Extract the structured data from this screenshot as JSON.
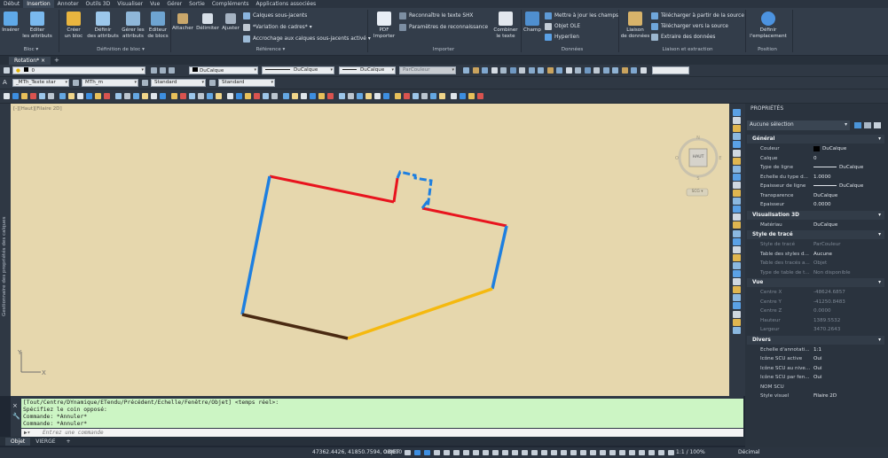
{
  "menu": [
    "Début",
    "Insertion",
    "Annoter",
    "Outils 3D",
    "Visualiser",
    "Vue",
    "Gérer",
    "Sortie",
    "Compléments",
    "Applications associées"
  ],
  "menu_active": "Insertion",
  "ribbon": {
    "inserer": "Insérer",
    "editer_attributs": "Editer\nles attributs",
    "creer_bloc": "Créer\nun bloc",
    "definir_attributs": "Définir\ndes attributs",
    "gerer_attributs": "Gérer les\nattributs",
    "editeur_blocs": "Editeur\nde blocs",
    "attacher": "Attacher",
    "delimiter": "Délimiter",
    "ajuster": "Ajuster",
    "calques_sous_jacents": "Calques sous-jacents",
    "variation_cadres": "*Variation de cadres*",
    "accrochage": "Accrochage aux calques sous-jacents activé",
    "pdf_importer": "PDF\nImporter",
    "reconnaitre_shx": "Reconnaître le texte SHX",
    "param_reconnaissance": "Paramètres de reconnaissance",
    "combiner_texte": "Combiner\nle texte",
    "champ": "Champ",
    "maj_champs": "Mettre à jour les champs",
    "objet_ole": "Objet OLE",
    "hyperlien": "Hyperlien",
    "liaison_donnees": "Liaison\nde données",
    "telecharger_source": "Télécharger à partir de la source",
    "telecharger_vers": "Télécharger vers la source",
    "extraire_donnees": "Extraire des  données",
    "definir_emplacement": "Définir\nl'emplacement",
    "groups": {
      "bloc": "Bloc",
      "def_bloc": "Définition de bloc",
      "reference": "Référence",
      "importer": "Importer",
      "donnees": "Données",
      "liaison": "Liaison et extraction",
      "position": "Position"
    }
  },
  "doc_tab": "Rotation*",
  "toolbar1": {
    "layer": "0",
    "color": "DuCalque",
    "linetype": "DuCalque",
    "lineweight": "DuCalque",
    "plotstyle": "ParCouleur"
  },
  "toolbar2": {
    "text_style": "_MTh_Texte star",
    "dim_style": "MTh_m",
    "table_style": "Standard",
    "multileader_style": "Standard"
  },
  "viewport_label": "[-][Haut][Filaire 2D]",
  "viewcube": {
    "face": "HAUT",
    "wcs": "SCG"
  },
  "left_palette_label": "Gestionnaire des propriétés des calques",
  "properties": {
    "title": "PROPRIÉTÉS",
    "selection": "Aucune sélection",
    "sections": [
      {
        "name": "Général",
        "rows": [
          {
            "k": "Couleur",
            "v": "DuCalque",
            "swatch": "#000000"
          },
          {
            "k": "Calque",
            "v": "0"
          },
          {
            "k": "Type de ligne",
            "v": "DuCalque",
            "line": true
          },
          {
            "k": "Echelle du type d...",
            "v": "1.0000"
          },
          {
            "k": "Epaisseur de ligne",
            "v": "DuCalque",
            "line": true
          },
          {
            "k": "Transparence",
            "v": "DuCalque"
          },
          {
            "k": "Epaisseur",
            "v": "0.0000"
          }
        ]
      },
      {
        "name": "Visualisation 3D",
        "rows": [
          {
            "k": "Matériau",
            "v": "DuCalque"
          }
        ]
      },
      {
        "name": "Style de tracé",
        "rows": [
          {
            "k": "Style de tracé",
            "v": "ParCouleur",
            "dim": true
          },
          {
            "k": "Table des styles d...",
            "v": "Aucune"
          },
          {
            "k": "Table des tracés a...",
            "v": "Objet",
            "dim": true
          },
          {
            "k": "Type de table de t...",
            "v": "Non disponible",
            "dim": true
          }
        ]
      },
      {
        "name": "Vue",
        "rows": [
          {
            "k": "Centre X",
            "v": "-48624.6857",
            "dim": true
          },
          {
            "k": "Centre Y",
            "v": "-41250.8483",
            "dim": true
          },
          {
            "k": "Centre Z",
            "v": "0.0000",
            "dim": true
          },
          {
            "k": "Hauteur",
            "v": "1389.5532",
            "dim": true
          },
          {
            "k": "Largeur",
            "v": "3470.2643",
            "dim": true
          }
        ]
      },
      {
        "name": "Divers",
        "rows": [
          {
            "k": "Echelle d'annotati...",
            "v": "1:1"
          },
          {
            "k": "Icône SCU active",
            "v": "Oui"
          },
          {
            "k": "Icône SCU au nive...",
            "v": "Oui"
          },
          {
            "k": "Icône SCU par fen...",
            "v": "Oui"
          },
          {
            "k": "NOM SCU",
            "v": ""
          },
          {
            "k": "Style visuel",
            "v": "Filaire 2D"
          }
        ]
      }
    ]
  },
  "command": {
    "history": [
      "[Tout/Centre/DYnamique/ETendu/Précédent/Echelle/Fenêtre/Objet] <temps réel>:",
      "Spécifiez le coin opposé:",
      "Commande: *Annuler*",
      "Commande: *Annuler*"
    ],
    "placeholder": "Entrez une commande"
  },
  "layout_tabs": [
    "Objet",
    "VIERGE"
  ],
  "status": {
    "coords": "47362.4426, 41850.7594, 0.0000",
    "model": "OBJET",
    "scale": "1:1 / 100%",
    "units": "Décimal"
  },
  "colors": {
    "red": "#e8141e",
    "blue": "#1e7fe0",
    "yellow": "#f5b90f",
    "brown": "#4a2a12",
    "canvas": "#e6d7ad"
  }
}
